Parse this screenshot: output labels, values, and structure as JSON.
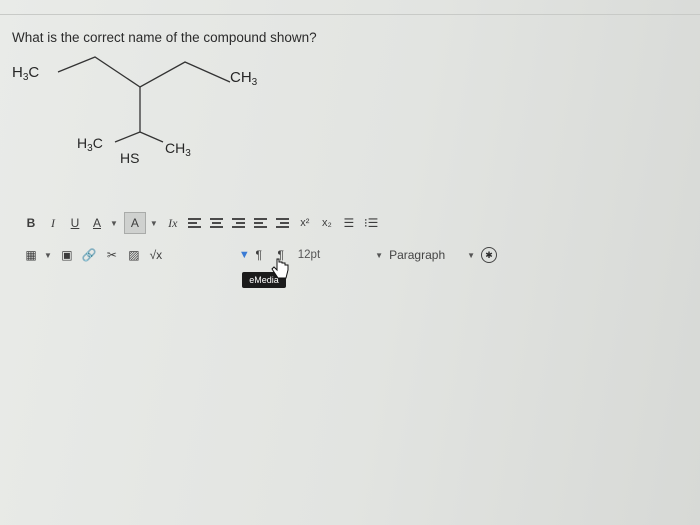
{
  "question": {
    "text": "What is the correct name of the compound shown?"
  },
  "molecule": {
    "labels": {
      "top_left": "H3C",
      "top_right": "CH3",
      "branch_left": "H3C",
      "branch_mid": "HS",
      "branch_right": "CH3"
    }
  },
  "toolbar": {
    "row1": {
      "bold": "B",
      "italic": "I",
      "underline": "U",
      "font_color": "A",
      "highlight": "A",
      "clear_format": "Ix",
      "superscript": "x²",
      "subscript": "x₂"
    },
    "row2": {
      "math": "√x",
      "font_size": "12pt",
      "format": "Paragraph"
    },
    "icons": {
      "table": "table-icon",
      "media": "media-icon",
      "link": "link-icon",
      "unlink": "unlink-icon",
      "image": "image-icon",
      "math": "sqrt-icon",
      "ltr": "ltr-paragraph-icon",
      "rtl": "rtl-paragraph-icon",
      "accessibility": "accessibility-icon"
    },
    "emedia_button": "eMedia"
  },
  "colors": {
    "background": "#e4e6e3",
    "accent": "#3a7bd5"
  }
}
